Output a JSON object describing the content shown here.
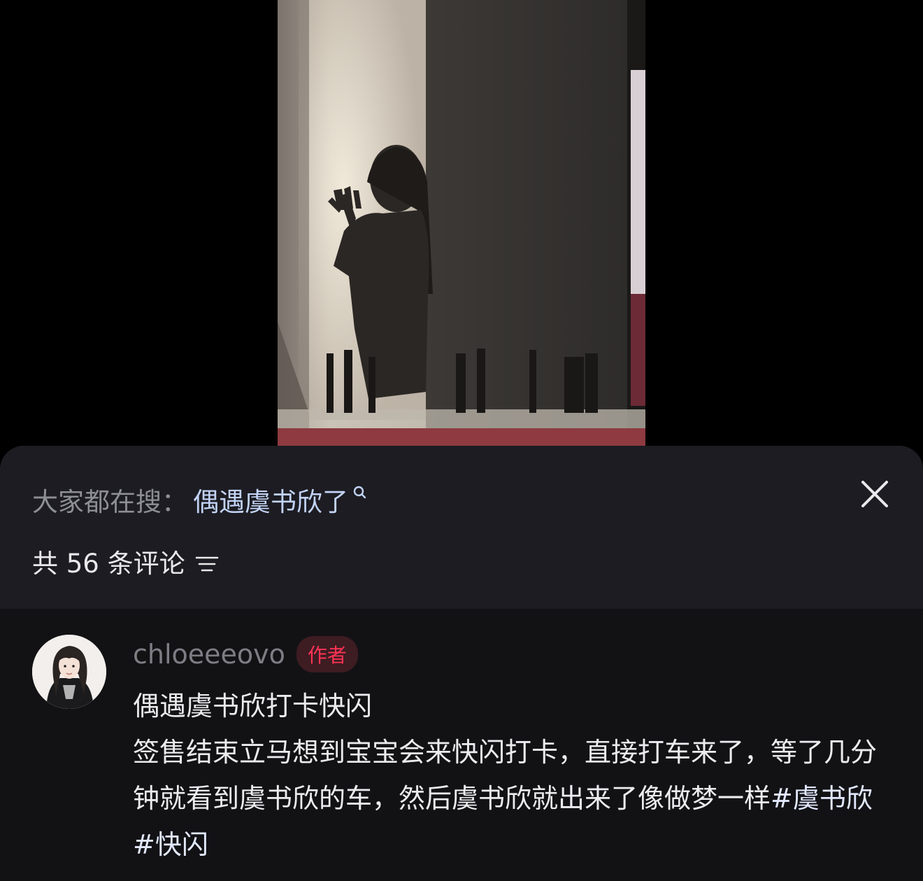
{
  "video": {
    "description_icon": "video-frame"
  },
  "search": {
    "prefix": "大家都在搜：",
    "term": "偶遇虞书欣了"
  },
  "comments_header": {
    "count_label": "共 56 条评论"
  },
  "comment": {
    "username": "chloeeeovo",
    "badge": "作者",
    "title": "偶遇虞书欣打卡快闪",
    "text": "签售结束立马想到宝宝会来快闪打卡，直接打车来了，等了几分钟就看到虞书欣的车，然后虞书欣就出来了像做梦一样",
    "hashtag1": "#虞书欣",
    "hashtag2": "#快闪"
  },
  "colors": {
    "sheet_bg": "#1c1c22",
    "comments_bg": "#121215",
    "search_term": "#c2d3f5",
    "badge_text": "#ff3355"
  }
}
